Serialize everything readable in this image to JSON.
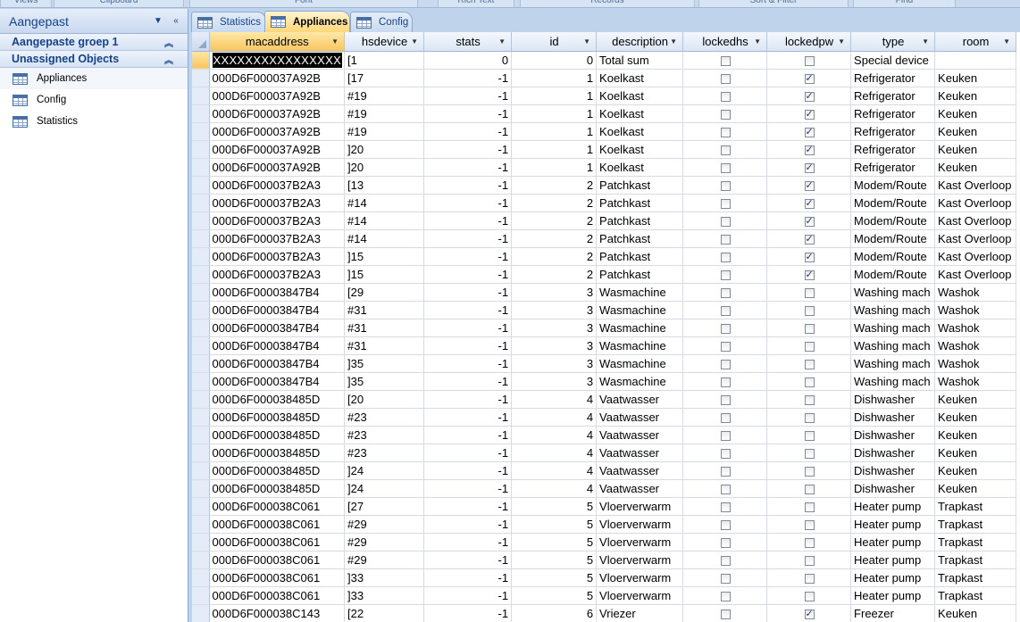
{
  "ribbon": {
    "groups": [
      "Views",
      "Clipboard",
      "Font",
      "Rich Text",
      "Records",
      "Sort & Filter",
      "Find"
    ]
  },
  "nav": {
    "title": "Aangepast",
    "groups": [
      {
        "label": "Aangepaste groep 1",
        "items": []
      },
      {
        "label": "Unassigned Objects",
        "items": [
          "Appliances",
          "Config",
          "Statistics"
        ]
      }
    ]
  },
  "tabs": [
    {
      "label": "Statistics",
      "active": false
    },
    {
      "label": "Appliances",
      "active": true
    },
    {
      "label": "Config",
      "active": false
    }
  ],
  "grid": {
    "columns": [
      "macaddress",
      "hsdevice",
      "stats",
      "id",
      "description",
      "lockedhs",
      "lockedpw",
      "type",
      "room"
    ],
    "editing_value": "XXXXXXXXXXXXXXXX",
    "rows": [
      [
        "XXXXXXXXXXXXXXXX",
        "[1",
        "0",
        "0",
        "Total sum",
        false,
        false,
        "Special device",
        ""
      ],
      [
        "000D6F000037A92B",
        "[17",
        "-1",
        "1",
        "Koelkast",
        false,
        true,
        "Refrigerator",
        "Keuken"
      ],
      [
        "000D6F000037A92B",
        "#19",
        "-1",
        "1",
        "Koelkast",
        false,
        true,
        "Refrigerator",
        "Keuken"
      ],
      [
        "000D6F000037A92B",
        "#19",
        "-1",
        "1",
        "Koelkast",
        false,
        true,
        "Refrigerator",
        "Keuken"
      ],
      [
        "000D6F000037A92B",
        "#19",
        "-1",
        "1",
        "Koelkast",
        false,
        true,
        "Refrigerator",
        "Keuken"
      ],
      [
        "000D6F000037A92B",
        "]20",
        "-1",
        "1",
        "Koelkast",
        false,
        true,
        "Refrigerator",
        "Keuken"
      ],
      [
        "000D6F000037A92B",
        "]20",
        "-1",
        "1",
        "Koelkast",
        false,
        true,
        "Refrigerator",
        "Keuken"
      ],
      [
        "000D6F000037B2A3",
        "[13",
        "-1",
        "2",
        "Patchkast",
        false,
        true,
        "Modem/Route",
        "Kast Overloop"
      ],
      [
        "000D6F000037B2A3",
        "#14",
        "-1",
        "2",
        "Patchkast",
        false,
        true,
        "Modem/Route",
        "Kast Overloop"
      ],
      [
        "000D6F000037B2A3",
        "#14",
        "-1",
        "2",
        "Patchkast",
        false,
        true,
        "Modem/Route",
        "Kast Overloop"
      ],
      [
        "000D6F000037B2A3",
        "#14",
        "-1",
        "2",
        "Patchkast",
        false,
        true,
        "Modem/Route",
        "Kast Overloop"
      ],
      [
        "000D6F000037B2A3",
        "]15",
        "-1",
        "2",
        "Patchkast",
        false,
        true,
        "Modem/Route",
        "Kast Overloop"
      ],
      [
        "000D6F000037B2A3",
        "]15",
        "-1",
        "2",
        "Patchkast",
        false,
        true,
        "Modem/Route",
        "Kast Overloop"
      ],
      [
        "000D6F00003847B4",
        "[29",
        "-1",
        "3",
        "Wasmachine",
        false,
        false,
        "Washing mach",
        "Washok"
      ],
      [
        "000D6F00003847B4",
        "#31",
        "-1",
        "3",
        "Wasmachine",
        false,
        false,
        "Washing mach",
        "Washok"
      ],
      [
        "000D6F00003847B4",
        "#31",
        "-1",
        "3",
        "Wasmachine",
        false,
        false,
        "Washing mach",
        "Washok"
      ],
      [
        "000D6F00003847B4",
        "#31",
        "-1",
        "3",
        "Wasmachine",
        false,
        false,
        "Washing mach",
        "Washok"
      ],
      [
        "000D6F00003847B4",
        "]35",
        "-1",
        "3",
        "Wasmachine",
        false,
        false,
        "Washing mach",
        "Washok"
      ],
      [
        "000D6F00003847B4",
        "]35",
        "-1",
        "3",
        "Wasmachine",
        false,
        false,
        "Washing mach",
        "Washok"
      ],
      [
        "000D6F000038485D",
        "[20",
        "-1",
        "4",
        "Vaatwasser",
        false,
        false,
        "Dishwasher",
        "Keuken"
      ],
      [
        "000D6F000038485D",
        "#23",
        "-1",
        "4",
        "Vaatwasser",
        false,
        false,
        "Dishwasher",
        "Keuken"
      ],
      [
        "000D6F000038485D",
        "#23",
        "-1",
        "4",
        "Vaatwasser",
        false,
        false,
        "Dishwasher",
        "Keuken"
      ],
      [
        "000D6F000038485D",
        "#23",
        "-1",
        "4",
        "Vaatwasser",
        false,
        false,
        "Dishwasher",
        "Keuken"
      ],
      [
        "000D6F000038485D",
        "]24",
        "-1",
        "4",
        "Vaatwasser",
        false,
        false,
        "Dishwasher",
        "Keuken"
      ],
      [
        "000D6F000038485D",
        "]24",
        "-1",
        "4",
        "Vaatwasser",
        false,
        false,
        "Dishwasher",
        "Keuken"
      ],
      [
        "000D6F000038C061",
        "[27",
        "-1",
        "5",
        "Vloerverwarm",
        false,
        false,
        "Heater pump",
        "Trapkast"
      ],
      [
        "000D6F000038C061",
        "#29",
        "-1",
        "5",
        "Vloerverwarm",
        false,
        false,
        "Heater pump",
        "Trapkast"
      ],
      [
        "000D6F000038C061",
        "#29",
        "-1",
        "5",
        "Vloerverwarm",
        false,
        false,
        "Heater pump",
        "Trapkast"
      ],
      [
        "000D6F000038C061",
        "#29",
        "-1",
        "5",
        "Vloerverwarm",
        false,
        false,
        "Heater pump",
        "Trapkast"
      ],
      [
        "000D6F000038C061",
        "]33",
        "-1",
        "5",
        "Vloerverwarm",
        false,
        false,
        "Heater pump",
        "Trapkast"
      ],
      [
        "000D6F000038C061",
        "]33",
        "-1",
        "5",
        "Vloerverwarm",
        false,
        false,
        "Heater pump",
        "Trapkast"
      ],
      [
        "000D6F000038C143",
        "[22",
        "-1",
        "6",
        "Vriezer",
        false,
        true,
        "Freezer",
        "Keuken"
      ]
    ]
  }
}
